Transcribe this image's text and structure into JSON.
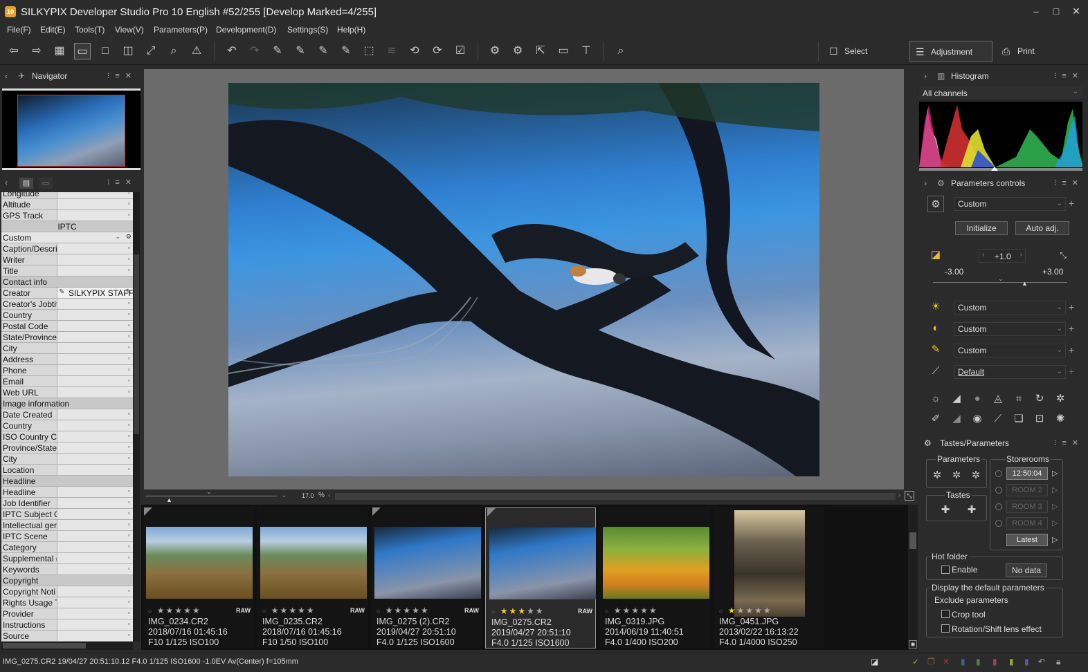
{
  "window": {
    "title": "SILKYPIX Developer Studio Pro 10 English   #52/255 [Develop Marked=4/255]",
    "logo": "10"
  },
  "menu": [
    "File(F)",
    "Edit(E)",
    "Tools(T)",
    "View(V)",
    "Parameters(P)",
    "Development(D)",
    "Settings(S)",
    "Help(H)"
  ],
  "modes": {
    "select": "Select",
    "adjustment": "Adjustment",
    "print": "Print"
  },
  "navigator": {
    "title": "Navigator"
  },
  "info_rows": [
    {
      "k": "Longitude",
      "type": "field"
    },
    {
      "k": "Altitude",
      "type": "field"
    },
    {
      "k": "GPS Track",
      "type": "field"
    },
    {
      "k": "IPTC",
      "type": "center"
    },
    {
      "k": "Custom",
      "type": "select"
    },
    {
      "k": "Caption/Descri",
      "type": "field"
    },
    {
      "k": "Writer",
      "type": "field"
    },
    {
      "k": "Title",
      "type": "field"
    },
    {
      "k": "Contact info",
      "type": "section"
    },
    {
      "k": "Creator",
      "type": "value",
      "v": "SILKYPIX STAFF"
    },
    {
      "k": "Creator's Jobtit",
      "type": "field"
    },
    {
      "k": "Country",
      "type": "field"
    },
    {
      "k": "Postal Code",
      "type": "field"
    },
    {
      "k": "State/Province",
      "type": "field"
    },
    {
      "k": "City",
      "type": "field"
    },
    {
      "k": "Address",
      "type": "field"
    },
    {
      "k": "Phone",
      "type": "field"
    },
    {
      "k": "Email",
      "type": "field"
    },
    {
      "k": "Web URL",
      "type": "field"
    },
    {
      "k": "Image information",
      "type": "section"
    },
    {
      "k": "Date Created",
      "type": "field"
    },
    {
      "k": "Country",
      "type": "field"
    },
    {
      "k": "ISO Country Co",
      "type": "field"
    },
    {
      "k": "Province/State",
      "type": "field"
    },
    {
      "k": "City",
      "type": "field"
    },
    {
      "k": "Location",
      "type": "field"
    },
    {
      "k": "Headline",
      "type": "section"
    },
    {
      "k": "Headline",
      "type": "field"
    },
    {
      "k": "Job Identifier",
      "type": "field"
    },
    {
      "k": "IPTC Subject C",
      "type": "field"
    },
    {
      "k": "Intellectual ger",
      "type": "field"
    },
    {
      "k": "IPTC Scene",
      "type": "field"
    },
    {
      "k": "Category",
      "type": "field"
    },
    {
      "k": "Supplemental (",
      "type": "field"
    },
    {
      "k": "Keywords",
      "type": "field"
    },
    {
      "k": "Copyright",
      "type": "section"
    },
    {
      "k": "Copyright Noti",
      "type": "field"
    },
    {
      "k": "Rights Usage T",
      "type": "field"
    },
    {
      "k": "Provider",
      "type": "field"
    },
    {
      "k": "Instructions",
      "type": "field"
    },
    {
      "k": "Source",
      "type": "field"
    }
  ],
  "viewer": {
    "zoom": "17.0",
    "zoom_unit": "%"
  },
  "filmstrip": [
    {
      "name": "IMG_0234.CR2",
      "date": "2018/07/16 01:45:16",
      "exif": "F10 1/125 ISO100",
      "stars": 0,
      "raw": "RAW",
      "kind": "hill"
    },
    {
      "name": "IMG_0235.CR2",
      "date": "2018/07/16 01:45:16",
      "exif": "F10 1/50 ISO100",
      "stars": 0,
      "raw": "RAW",
      "kind": "hill"
    },
    {
      "name": "IMG_0275 (2).CR2",
      "date": "2019/04/27 20:51:10",
      "exif": "F4.0 1/125 ISO1600",
      "stars": 0,
      "raw": "RAW",
      "kind": "beach"
    },
    {
      "name": "IMG_0275.CR2",
      "date": "2019/04/27 20:51:10",
      "exif": "F4.0 1/125 ISO1600",
      "stars": 3,
      "raw": "RAW",
      "kind": "beach"
    },
    {
      "name": "IMG_0319.JPG",
      "date": "2014/06/19 11:40:51",
      "exif": "F4.0 1/400 ISO200",
      "stars": 0,
      "raw": "",
      "kind": "flower"
    },
    {
      "name": "IMG_0451.JPG",
      "date": "2013/02/22 16:13:22",
      "exif": "F4.0 1/4000 ISO250",
      "stars": 1,
      "raw": "",
      "kind": "street"
    }
  ],
  "status": "IMG_0275.CR2 19/04/27 20:51:10.12 F4.0 1/125 ISO1600 -1.0EV Av(Center) f=105mm",
  "histogram": {
    "title": "Histogram",
    "channels": "All channels"
  },
  "params": {
    "title": "Parameters controls",
    "preset": "Custom",
    "initialize": "Initialize",
    "auto": "Auto adj.",
    "exposure_value": "+1.0",
    "exp_min": "-3.00",
    "exp_max": "+3.00",
    "wb": "Custom",
    "tone": "Custom",
    "sharp": "Custom",
    "noise": "Default"
  },
  "tastes": {
    "title": "Tastes/Parameters",
    "parameters": "Parameters",
    "storerooms": "Storerooms",
    "tastes_label": "Tastes",
    "rooms": [
      "12:50:04",
      "ROOM 2",
      "ROOM 3",
      "ROOM 4"
    ],
    "latest": "Latest",
    "hot_folder": "Hot folder",
    "enable": "Enable",
    "no_data": "No data",
    "display_default": "Display the default parameters",
    "exclude": "Exclude parameters",
    "crop": "Crop tool",
    "rotation": "Rotation/Shift lens effect"
  }
}
